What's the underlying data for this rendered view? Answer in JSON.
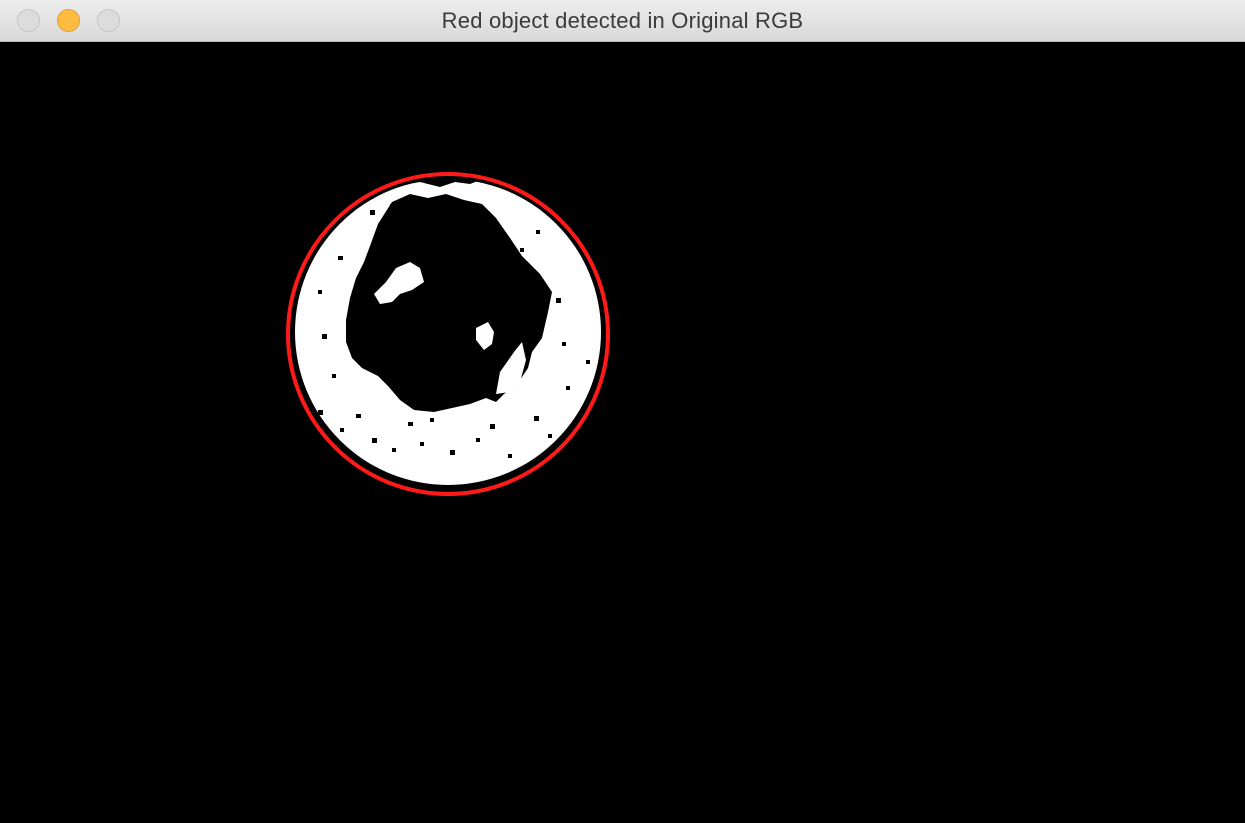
{
  "window": {
    "title": "Red object detected in Original RGB",
    "buttons": {
      "close": "close-icon",
      "minimize": "minimize-icon",
      "zoom": "zoom-icon"
    }
  },
  "image": {
    "background_color": "#000000",
    "mask_color": "#ffffff",
    "detection_circle_color": "#ff1a1a"
  }
}
